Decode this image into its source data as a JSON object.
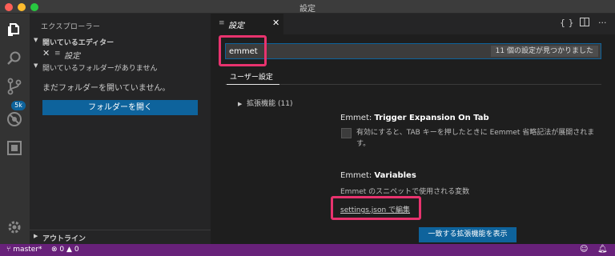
{
  "window": {
    "title": "設定"
  },
  "activity_bar": {
    "icons": [
      "files-icon",
      "search-icon",
      "source-control-icon",
      "debug-icon",
      "extensions-icon",
      "gear-icon"
    ],
    "scm_badge": "5k"
  },
  "sidebar": {
    "title": "エクスプローラー",
    "open_editors": {
      "header": "開いているエディター",
      "items": [
        {
          "name": "設定"
        }
      ]
    },
    "no_folder_header": "開いているフォルダーがありません",
    "no_folder_message": "まだフォルダーを開いていません。",
    "open_folder_button": "フォルダーを開く",
    "outline_header": "アウトライン"
  },
  "editor": {
    "tab": {
      "label": "設定"
    },
    "actions": [
      "{ }",
      "split-icon",
      "···"
    ],
    "search": {
      "value": "emmet",
      "result_count": "11 個の設定が見つかりました"
    },
    "settings_tab": "ユーザー設定",
    "extensions_group": "拡張機能 (11)",
    "settings": [
      {
        "prefix": "Emmet: ",
        "name": "Trigger Expansion On Tab",
        "description": "有効にすると、TAB キーを押したときに Eemmet 省略記法が展開されます。",
        "checked": false
      },
      {
        "prefix": "Emmet: ",
        "name": "Variables",
        "description": "Emmet のスニペットで使用される変数",
        "link": "settings.json で編集"
      }
    ],
    "show_matching_extensions_button": "一致する拡張機能を表示"
  },
  "status_bar": {
    "branch": "master*",
    "errors": "0",
    "warnings": "0"
  },
  "colors": {
    "status_bar": "#68217a",
    "accent_button": "#0e639c",
    "highlight_annotation": "#e8336e"
  }
}
